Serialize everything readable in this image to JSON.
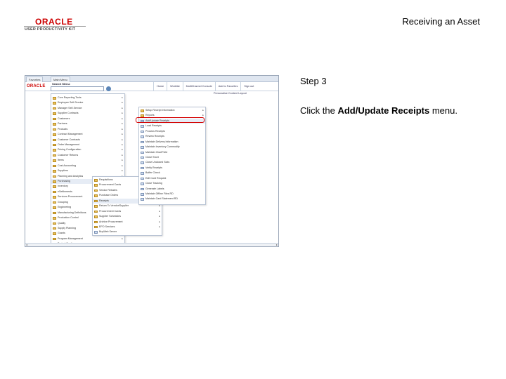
{
  "header": {
    "brand": "ORACLE",
    "brand_sub": "USER PRODUCTIVITY KIT",
    "page_title": "Receiving an Asset"
  },
  "step": {
    "label": "Step 3",
    "instruction_prefix": "Click the ",
    "instruction_target": "Add/Update Receipts",
    "instruction_suffix": " menu."
  },
  "screenshot": {
    "tabs": [
      "Favorites",
      "Main Menu"
    ],
    "header_links": [
      "Home",
      "Worklist",
      "MultiChannel Console",
      "Add to Favorites",
      "Sign out"
    ],
    "personalize": "Personalize Content  Layout",
    "search_label": "Search Menu:",
    "main_menu": [
      {
        "label": "Core Reporting Tools",
        "arrow": true
      },
      {
        "label": "Employee Self-Service",
        "arrow": true
      },
      {
        "label": "Manager Self-Service",
        "arrow": true
      },
      {
        "label": "Supplier Contracts",
        "arrow": true
      },
      {
        "label": "Customers",
        "arrow": true
      },
      {
        "label": "Partners",
        "arrow": true
      },
      {
        "label": "Products",
        "arrow": true
      },
      {
        "label": "Contract Management",
        "arrow": true
      },
      {
        "label": "Customer Contracts",
        "arrow": true
      },
      {
        "label": "Order Management",
        "arrow": true
      },
      {
        "label": "Pricing Configuration",
        "arrow": true
      },
      {
        "label": "Customer Returns",
        "arrow": true
      },
      {
        "label": "Items",
        "arrow": true
      },
      {
        "label": "Cost Accounting",
        "arrow": true
      },
      {
        "label": "Suppliers",
        "arrow": true
      },
      {
        "label": "Planning and Analytics",
        "arrow": true
      },
      {
        "label": "Purchasing",
        "arrow": true,
        "highlight": true
      },
      {
        "label": "Inventory",
        "arrow": true
      },
      {
        "label": "eSettlements",
        "arrow": true
      },
      {
        "label": "Services Procurement",
        "arrow": true
      },
      {
        "label": "Grouping",
        "arrow": true
      },
      {
        "label": "Engineering",
        "arrow": true
      },
      {
        "label": "Manufacturing Definitions",
        "arrow": true
      },
      {
        "label": "Production Control",
        "arrow": true
      },
      {
        "label": "Quality",
        "arrow": true
      },
      {
        "label": "Supply Planning",
        "arrow": true
      },
      {
        "label": "Grants",
        "arrow": true
      },
      {
        "label": "Program Management",
        "arrow": true
      },
      {
        "label": "Project Costing",
        "arrow": true
      }
    ],
    "purchasing_menu": [
      {
        "label": "Requisitions",
        "arrow": true,
        "doc": false
      },
      {
        "label": "Procurement Cards",
        "arrow": true,
        "doc": false
      },
      {
        "label": "Vendor Rebates",
        "arrow": true,
        "doc": false
      },
      {
        "label": "Purchase Orders",
        "arrow": true,
        "doc": false
      },
      {
        "label": "Receipts",
        "arrow": true,
        "doc": false,
        "highlight": true
      },
      {
        "label": "Return To Vendor/Supplier",
        "arrow": true,
        "doc": false
      },
      {
        "label": "Procurement Cards",
        "arrow": true,
        "doc": false
      },
      {
        "label": "Supplier Schedules",
        "arrow": true,
        "doc": false
      },
      {
        "label": "Archive Procurement",
        "arrow": true,
        "doc": false
      },
      {
        "label": "EPO Services",
        "arrow": true,
        "doc": false
      },
      {
        "label": "BuyWeb Server",
        "arrow": false,
        "doc": true
      }
    ],
    "receipts_menu": [
      {
        "label": "Setup Receipt Information",
        "arrow": true,
        "doc": false
      },
      {
        "label": "Reports",
        "arrow": true,
        "doc": false
      },
      {
        "label": "Add/Update Receipts",
        "arrow": false,
        "doc": true,
        "highlight": true
      },
      {
        "label": "Load Receipts",
        "arrow": false,
        "doc": true
      },
      {
        "label": "Process Receipts",
        "arrow": false,
        "doc": true
      },
      {
        "label": "Review Receipts",
        "arrow": false,
        "doc": true
      },
      {
        "label": "Maintain Delivery Information",
        "arrow": false,
        "doc": true
      },
      {
        "label": "Maintain Inventory Commodity",
        "arrow": false,
        "doc": true
      },
      {
        "label": "Maintain ChartField",
        "arrow": false,
        "doc": true
      },
      {
        "label": "Close Short",
        "arrow": false,
        "doc": true
      },
      {
        "label": "Close Unclosed Slots",
        "arrow": false,
        "doc": true
      },
      {
        "label": "Verify Receipts",
        "arrow": false,
        "doc": true
      },
      {
        "label": "Buffer Check",
        "arrow": false,
        "doc": true
      },
      {
        "label": "Edit Card Request",
        "arrow": false,
        "doc": true
      },
      {
        "label": "Close Tracking",
        "arrow": false,
        "doc": true
      },
      {
        "label": "Generate Labels",
        "arrow": false,
        "doc": true
      },
      {
        "label": "Maintain Offline Files RD",
        "arrow": false,
        "doc": true
      },
      {
        "label": "Maintain Card Statement RD",
        "arrow": false,
        "doc": true
      }
    ]
  }
}
